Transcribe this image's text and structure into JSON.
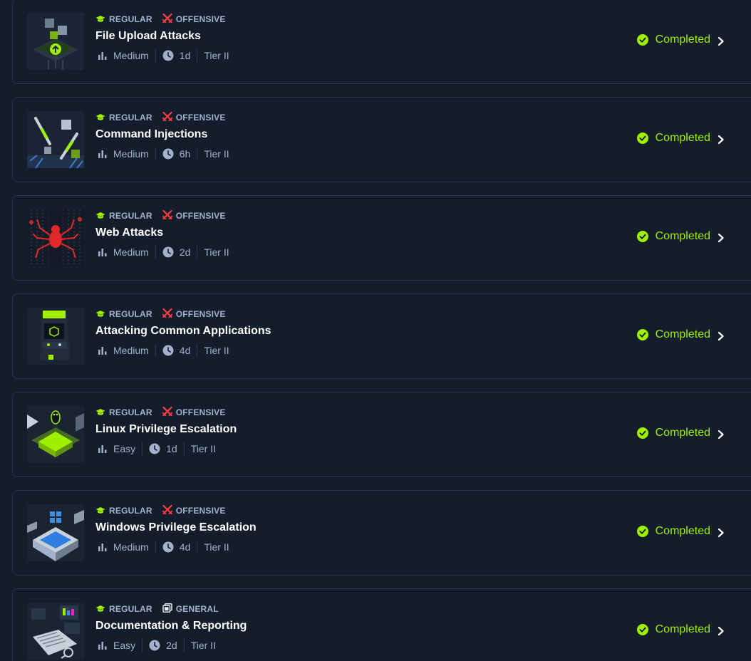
{
  "colors": {
    "background": "#141d2b",
    "card_border": "#2a3447",
    "accent_green": "#9fef00",
    "offensive_red": "#ff3e3e",
    "muted_text": "#a4b1cd",
    "title_text": "#ffffff"
  },
  "icons": {
    "regular": "graduation-cap-icon",
    "offensive": "crossed-swords-icon",
    "general": "book-stack-icon",
    "difficulty": "bar-chart-icon",
    "duration": "clock-icon",
    "status": "check-circle-icon",
    "open": "chevron-right-icon"
  },
  "modules": [
    {
      "type_label": "REGULAR",
      "category_label": "OFFENSIVE",
      "category_icon": "offensive",
      "title": "File Upload Attacks",
      "difficulty": "Medium",
      "duration": "1d",
      "tier": "Tier II",
      "status": "Completed",
      "thumb": "upload"
    },
    {
      "type_label": "REGULAR",
      "category_label": "OFFENSIVE",
      "category_icon": "offensive",
      "title": "Command Injections",
      "difficulty": "Medium",
      "duration": "6h",
      "tier": "Tier II",
      "status": "Completed",
      "thumb": "injection"
    },
    {
      "type_label": "REGULAR",
      "category_label": "OFFENSIVE",
      "category_icon": "offensive",
      "title": "Web Attacks",
      "difficulty": "Medium",
      "duration": "2d",
      "tier": "Tier II",
      "status": "Completed",
      "thumb": "spider"
    },
    {
      "type_label": "REGULAR",
      "category_label": "OFFENSIVE",
      "category_icon": "offensive",
      "title": "Attacking Common Applications",
      "difficulty": "Medium",
      "duration": "4d",
      "tier": "Tier II",
      "status": "Completed",
      "thumb": "arcade"
    },
    {
      "type_label": "REGULAR",
      "category_label": "OFFENSIVE",
      "category_icon": "offensive",
      "title": "Linux Privilege Escalation",
      "difficulty": "Easy",
      "duration": "1d",
      "tier": "Tier II",
      "status": "Completed",
      "thumb": "linux"
    },
    {
      "type_label": "REGULAR",
      "category_label": "OFFENSIVE",
      "category_icon": "offensive",
      "title": "Windows Privilege Escalation",
      "difficulty": "Medium",
      "duration": "4d",
      "tier": "Tier II",
      "status": "Completed",
      "thumb": "windows"
    },
    {
      "type_label": "REGULAR",
      "category_label": "GENERAL",
      "category_icon": "general",
      "title": "Documentation & Reporting",
      "difficulty": "Easy",
      "duration": "2d",
      "tier": "Tier II",
      "status": "Completed",
      "thumb": "docs"
    }
  ]
}
